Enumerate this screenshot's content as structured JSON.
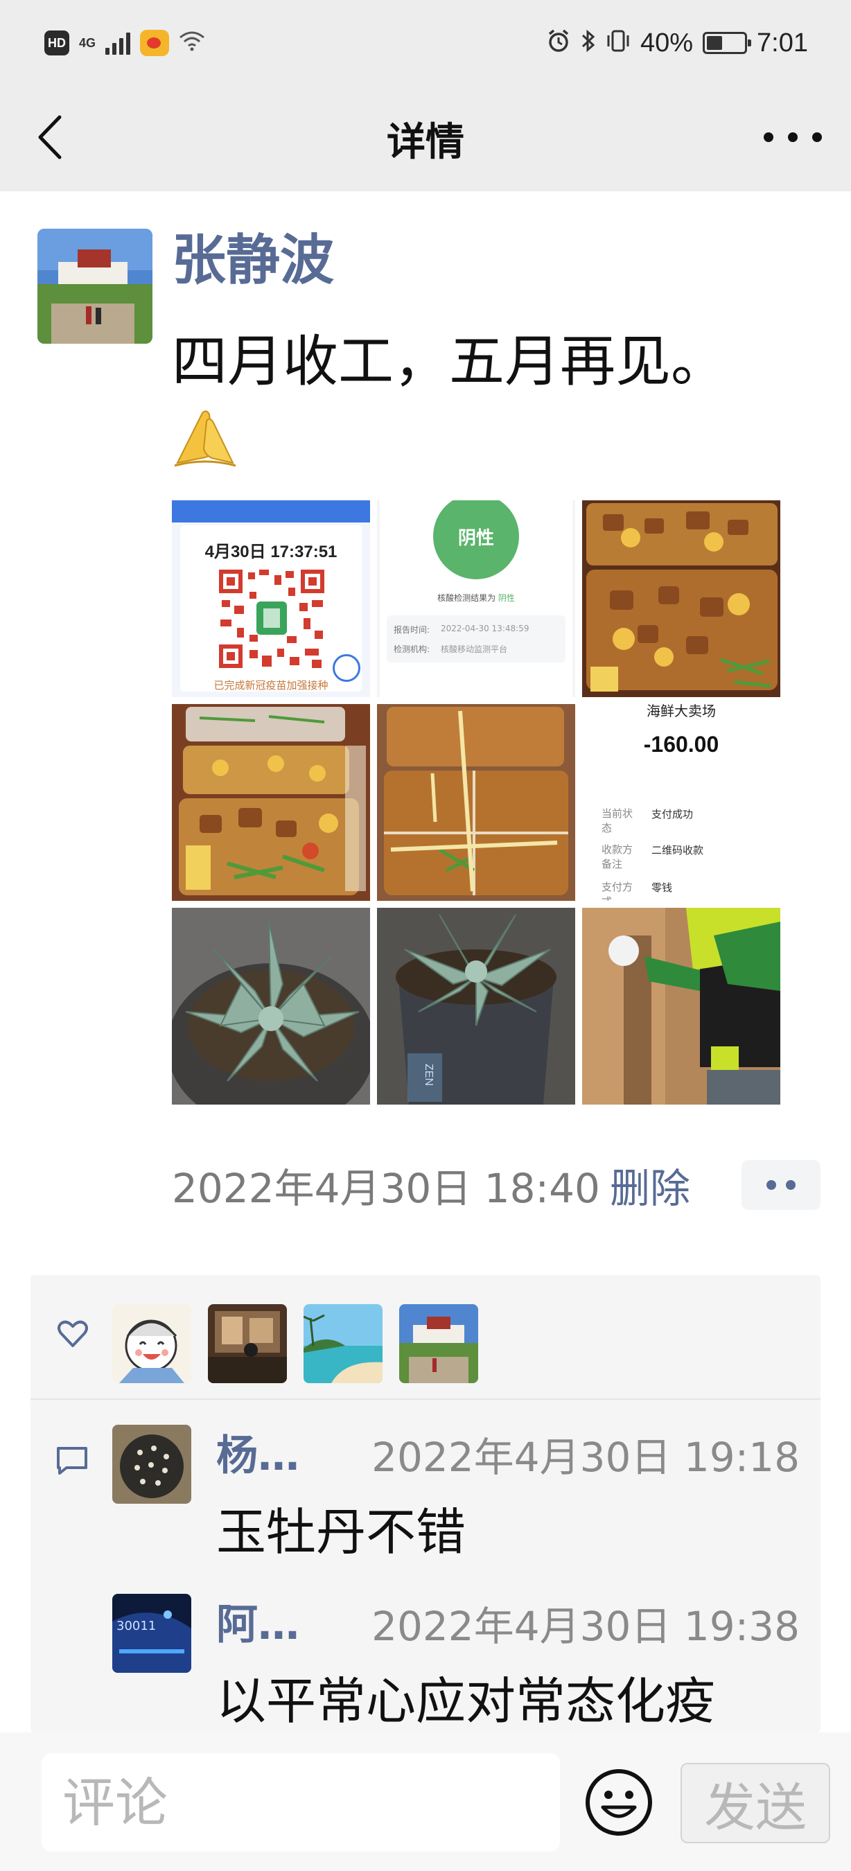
{
  "status_bar": {
    "hd_badge": "HD",
    "network": "4G",
    "battery_text": "40%",
    "time": "7:01",
    "icons": [
      "hd-icon",
      "signal-icon",
      "weibo-icon",
      "wifi-icon",
      "alarm-icon",
      "bluetooth-icon",
      "vibrate-icon",
      "battery-icon"
    ]
  },
  "nav": {
    "title": "详情",
    "back_icon": "chevron-left-icon",
    "more_icon": "more-icon"
  },
  "post": {
    "author": "张静波",
    "text": "四月收工，五月再见。",
    "emoji": "folded-hands-icon",
    "time": "2022年4月30日 18:40",
    "delete_label": "删除",
    "images": {
      "img1": {
        "date_time": "4月30日 17:37:51",
        "footer": "已完成新冠疫苗加强接种"
      },
      "img2": {
        "result": "阴性",
        "subtitle": "核酸检测结果为",
        "subtitle_result": "阴性",
        "row1_label": "报告时间:",
        "row1_value": "2022-04-30 13:48:59",
        "row2_label": "检测机构:",
        "row2_value": "核酸移动监测平台"
      },
      "img6": {
        "merchant": "海鲜大卖场",
        "amount": "-160.00",
        "rows": [
          {
            "label": "当前状态",
            "value": "支付成功"
          },
          {
            "label": "收款方备注",
            "value": "二维码收款"
          },
          {
            "label": "支付方式",
            "value": "零钱"
          }
        ]
      },
      "img8": {
        "pot_label": "ZEN"
      }
    }
  },
  "likes": {
    "icon": "heart-icon",
    "avatars": [
      "avatar-cartoon",
      "avatar-indoor",
      "avatar-beach",
      "avatar-palace"
    ]
  },
  "comments": {
    "icon": "comment-icon",
    "items": [
      {
        "name": "杨…",
        "time": "2022年4月30日 19:18",
        "text": "玉牡丹不错"
      },
      {
        "name": "阿…",
        "time": "2022年4月30日 19:38",
        "text": "以平常心应对常态化疫"
      }
    ]
  },
  "input_bar": {
    "placeholder": "评论",
    "emoji_icon": "smiley-icon",
    "send_label": "发送"
  },
  "colors": {
    "link": "#576b95",
    "bar_bg": "#ededed",
    "negative_green": "#5ab46b"
  }
}
